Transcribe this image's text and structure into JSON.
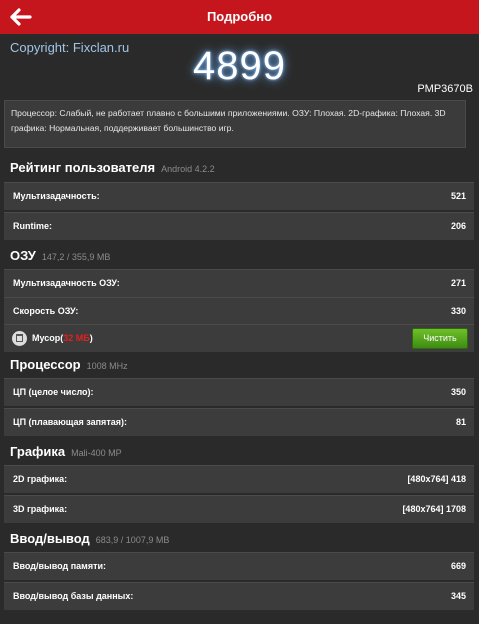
{
  "header": {
    "title": "Подробно"
  },
  "copyright": "Copyright: Fixclan.ru",
  "score": "4899",
  "device": "PMP3670B",
  "summary": "Процессор: Слабый, не работает плавно с большими приложениями. ОЗУ: Плохая. 2D-графика: Плохая. 3D графика: Нормальная, поддерживает большинство игр.",
  "sections": [
    {
      "title": "Рейтинг пользователя",
      "sub": "Android 4.2.2",
      "rows": [
        {
          "label": "Мультизадачность:",
          "value": "521"
        },
        {
          "label": "Runtime:",
          "value": "206"
        }
      ]
    },
    {
      "title": "ОЗУ",
      "sub": "147,2 / 355,9 MB",
      "rows": [
        {
          "label": "Мультизадачность ОЗУ:",
          "value": "271"
        },
        {
          "label": "Скорость ОЗУ:",
          "value": "330"
        }
      ],
      "junk": {
        "label": "Мусор",
        "amount": "32 МБ",
        "button": "Чистить"
      }
    },
    {
      "title": "Процессор",
      "sub": "1008 MHz",
      "rows": [
        {
          "label": "ЦП (целое число):",
          "value": "350"
        },
        {
          "label": "ЦП (плавающая запятая):",
          "value": "81"
        }
      ]
    },
    {
      "title": "Графика",
      "sub": "Mali-400 MP",
      "rows": [
        {
          "label": "2D графика:",
          "value": "[480x764] 418"
        },
        {
          "label": "3D графика:",
          "value": "[480x764] 1708"
        }
      ]
    },
    {
      "title": "Ввод/вывод",
      "sub": "683,9 / 1007,9 MB",
      "rows": [
        {
          "label": "Ввод/вывод памяти:",
          "value": "669"
        },
        {
          "label": "Ввод/вывод базы данных:",
          "value": "345"
        }
      ]
    }
  ],
  "colors": {
    "topbar": "#c4161c",
    "accent_red": "#e32020",
    "button_green": "#4ea51c"
  }
}
